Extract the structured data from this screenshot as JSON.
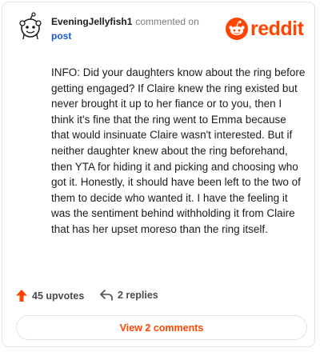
{
  "comment": {
    "username": "EveningJellyfish1",
    "action": "commented on",
    "post_link": "post",
    "body": "INFO: Did your daughters know about the ring before getting engaged? If Claire knew the ring existed but never brought it up to her fiance or to you, then I think it's fine that the ring went to Emma because that would insinuate Claire wasn't interested. But if neither daughter knew about the ring beforehand, then YTA for hiding it and picking and choosing who got it. Honestly, it should have been left to the two of them to decide who wanted it. I have the feeling it was the sentiment behind withholding it from Claire that has her upset moreso than the ring itself.",
    "upvotes_label": "45 upvotes",
    "replies_label": "2 replies",
    "view_comments_label": "View 2 comments"
  },
  "brand": {
    "wordmark": "reddit",
    "icon": "reddit-snoo-icon",
    "accent": "#ff4500"
  },
  "icons": {
    "avatar": "snoo-avatar-icon",
    "upvote": "upvote-arrow-icon",
    "reply": "reply-arrow-icon"
  },
  "colors": {
    "link": "#1a56db",
    "upvote": "#ff4500",
    "muted": "#7c7c7c"
  }
}
